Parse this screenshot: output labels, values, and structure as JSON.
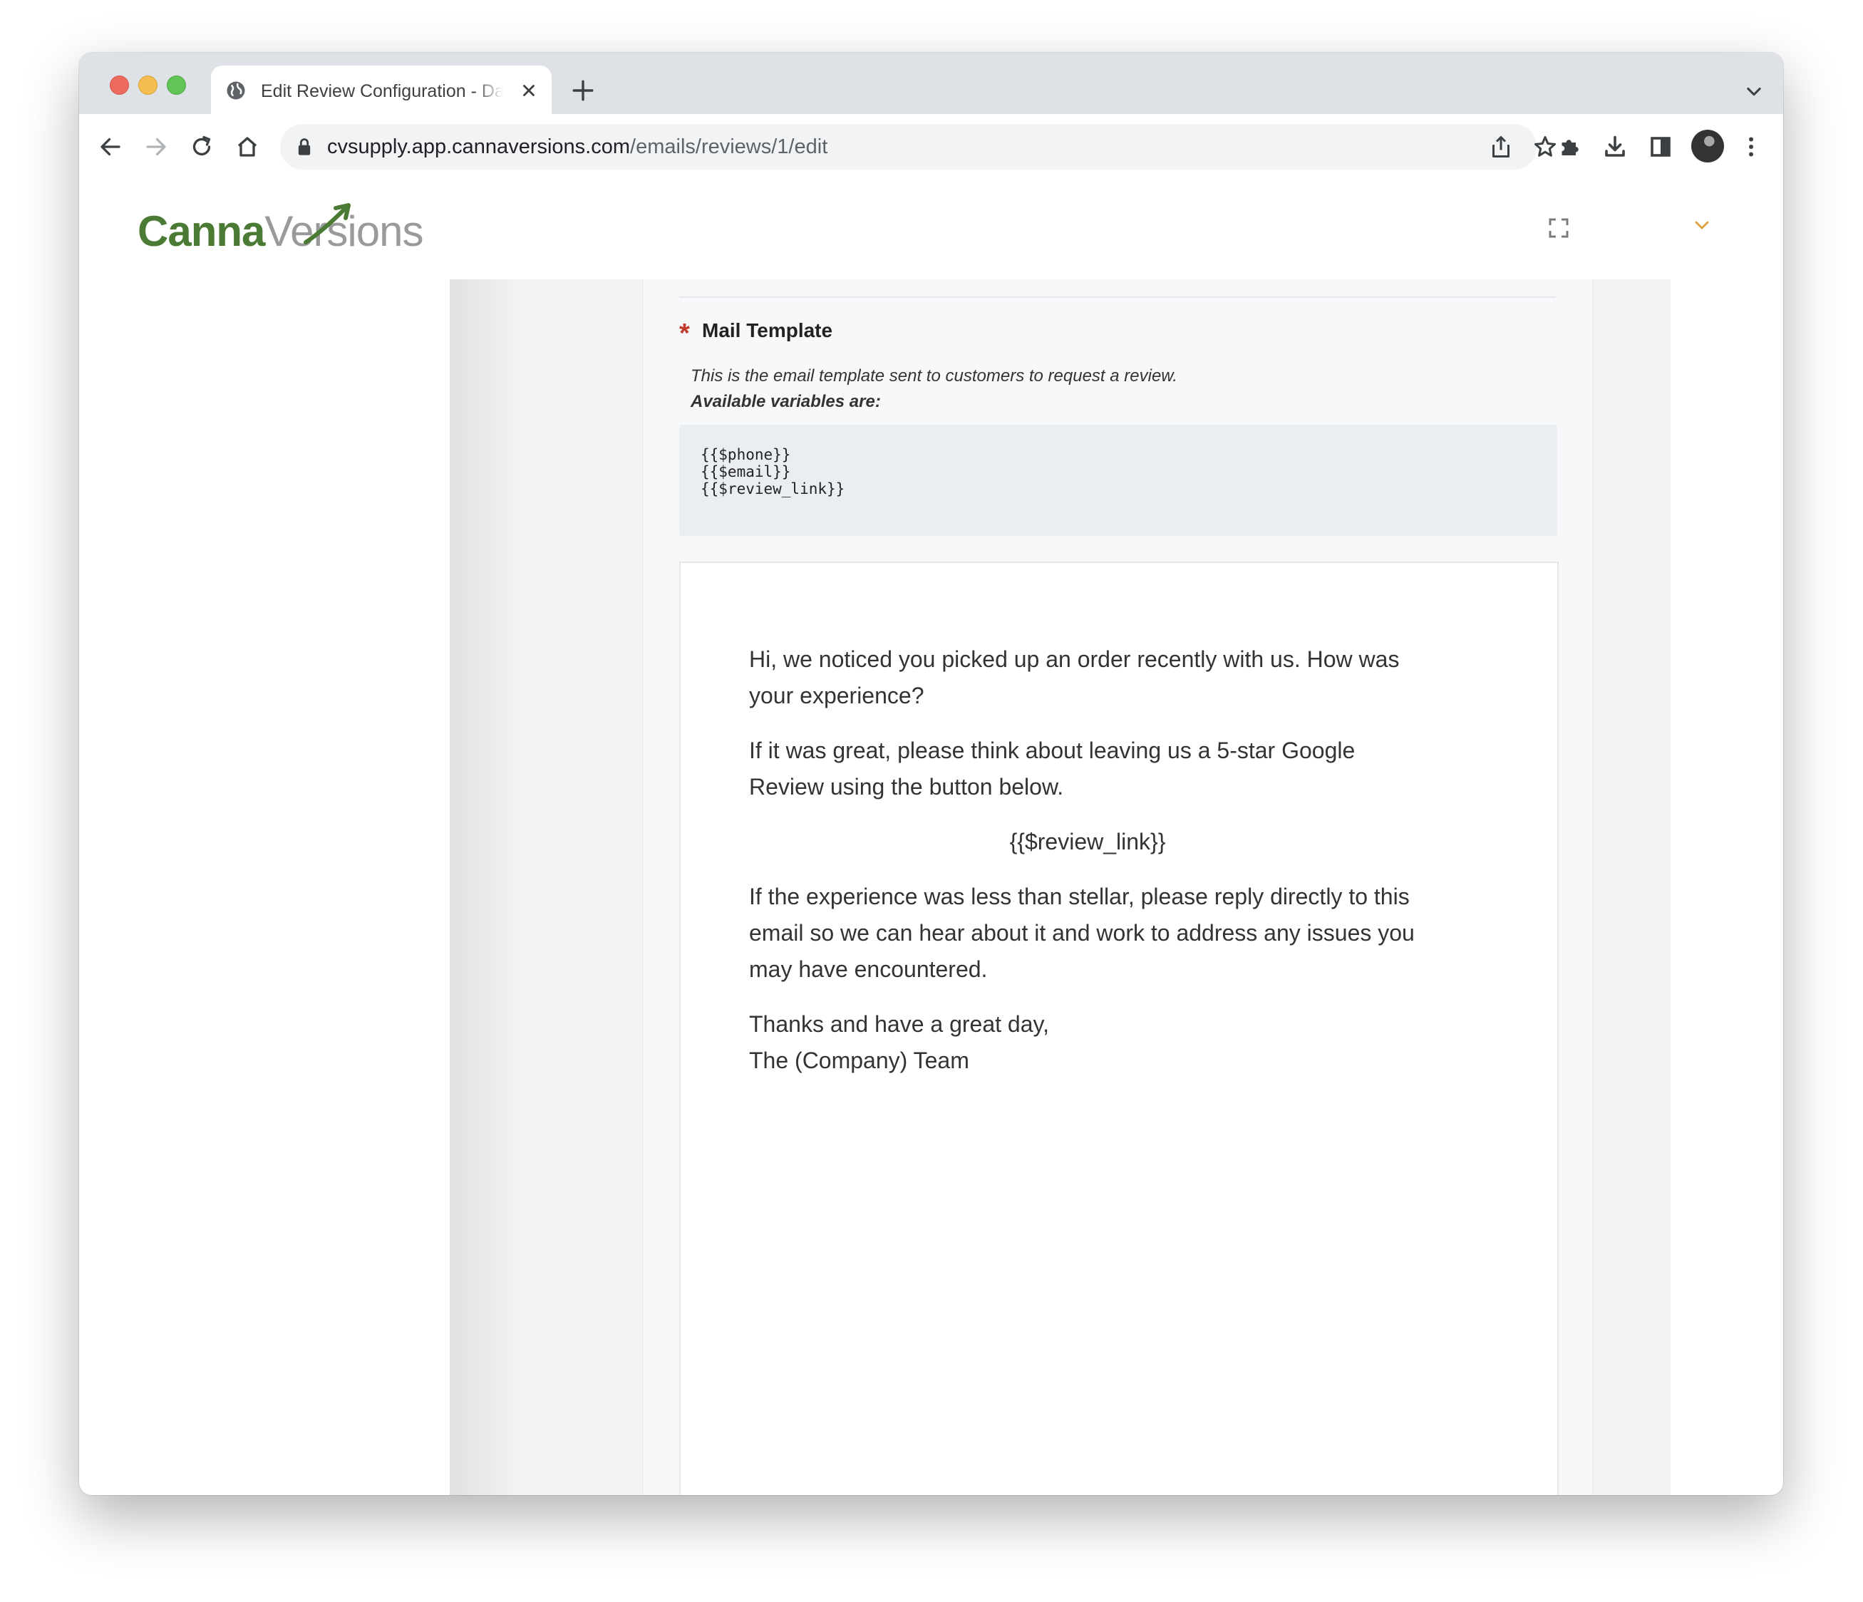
{
  "browser": {
    "tab_title": "Edit Review Configuration - Dashboard",
    "url_host": "cvsupply.app.cannaversions.com",
    "url_path": "/emails/reviews/1/edit"
  },
  "brand": {
    "logo_part1": "Canna",
    "logo_part2": "Versions",
    "primary_color": "#4a7a33",
    "secondary_color": "#9a9a9a",
    "accent_color": "#e0a040"
  },
  "form": {
    "mail_template": {
      "required_marker": "*",
      "label": "Mail Template",
      "help_text": "This is the email template sent to customers to request a review.",
      "variables_label": "Available variables are:",
      "variables": [
        "{{$phone}}",
        "{{$email}}",
        "{{$review_link}}"
      ]
    }
  },
  "email_body": {
    "p1": "Hi, we noticed you picked up an order recently with us. How was your experience?",
    "p2": "If it was great, please think about leaving us a 5-star Google Review using the button below.",
    "review_link": "{{$review_link}}",
    "p3": "If the experience was less than stellar, please reply directly to this email so we can hear about it and work to address any issues you may have encountered.",
    "closing_line1": "Thanks and have a great day,",
    "closing_line2": "The (Company) Team"
  }
}
